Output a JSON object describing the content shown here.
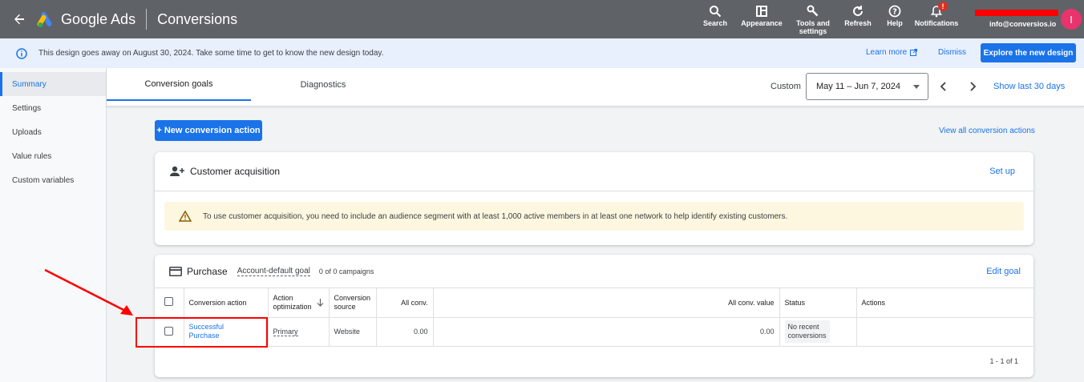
{
  "topbar": {
    "brand": "Google Ads",
    "page_title": "Conversions",
    "tools": [
      {
        "label": "Search",
        "icon": "search-icon"
      },
      {
        "label": "Appearance",
        "icon": "appearance-icon"
      },
      {
        "label": "Tools and settings",
        "icon": "wrench-icon"
      },
      {
        "label": "Refresh",
        "icon": "refresh-icon"
      },
      {
        "label": "Help",
        "icon": "help-icon"
      },
      {
        "label": "Notifications",
        "icon": "bell-icon",
        "badge": "!"
      }
    ],
    "email": "info@conversios.io",
    "avatar_letter": "I"
  },
  "banner": {
    "text": "This design goes away on August 30, 2024. Take some time to get to know the new design today.",
    "learn_more": "Learn more",
    "dismiss": "Dismiss",
    "explore": "Explore the new design"
  },
  "sidebar": {
    "items": [
      {
        "label": "Summary",
        "active": true
      },
      {
        "label": "Settings"
      },
      {
        "label": "Uploads"
      },
      {
        "label": "Value rules"
      },
      {
        "label": "Custom variables"
      }
    ]
  },
  "tabs": {
    "items": [
      {
        "label": "Conversion goals",
        "active": true
      },
      {
        "label": "Diagnostics"
      }
    ],
    "custom_label": "Custom",
    "date_range": "May 11 – Jun 7, 2024",
    "show_last": "Show last 30 days"
  },
  "main": {
    "new_button": "+ New conversion action",
    "view_all": "View all conversion actions"
  },
  "acquisition": {
    "title": "Customer acquisition",
    "setup": "Set up",
    "warning": "To use customer acquisition, you need to include an audience segment with at least 1,000 active members in at least one network to help identify existing customers."
  },
  "purchase": {
    "title": "Purchase",
    "account_default": "Account-default goal",
    "campaigns": "0 of 0 campaigns",
    "edit_goal": "Edit goal",
    "columns": {
      "action": "Conversion action",
      "optimization_1": "Action",
      "optimization_2": "optimization",
      "source_1": "Conversion",
      "source_2": "source",
      "all_conv": "All conv.",
      "all_conv_value": "All conv. value",
      "status": "Status",
      "actions": "Actions"
    },
    "rows": [
      {
        "action_1": "Successful",
        "action_2": "Purchase",
        "optimization": "Primary",
        "source": "Website",
        "all_conv": "0.00",
        "all_conv_value": "0.00",
        "status_1": "No recent",
        "status_2": "conversions"
      }
    ],
    "pagination": "1 - 1 of 1"
  },
  "colors": {
    "topbar": "#5f6368",
    "accent": "#1a73e8",
    "annotation": "#ff0000",
    "avatar": "#e8336c"
  }
}
